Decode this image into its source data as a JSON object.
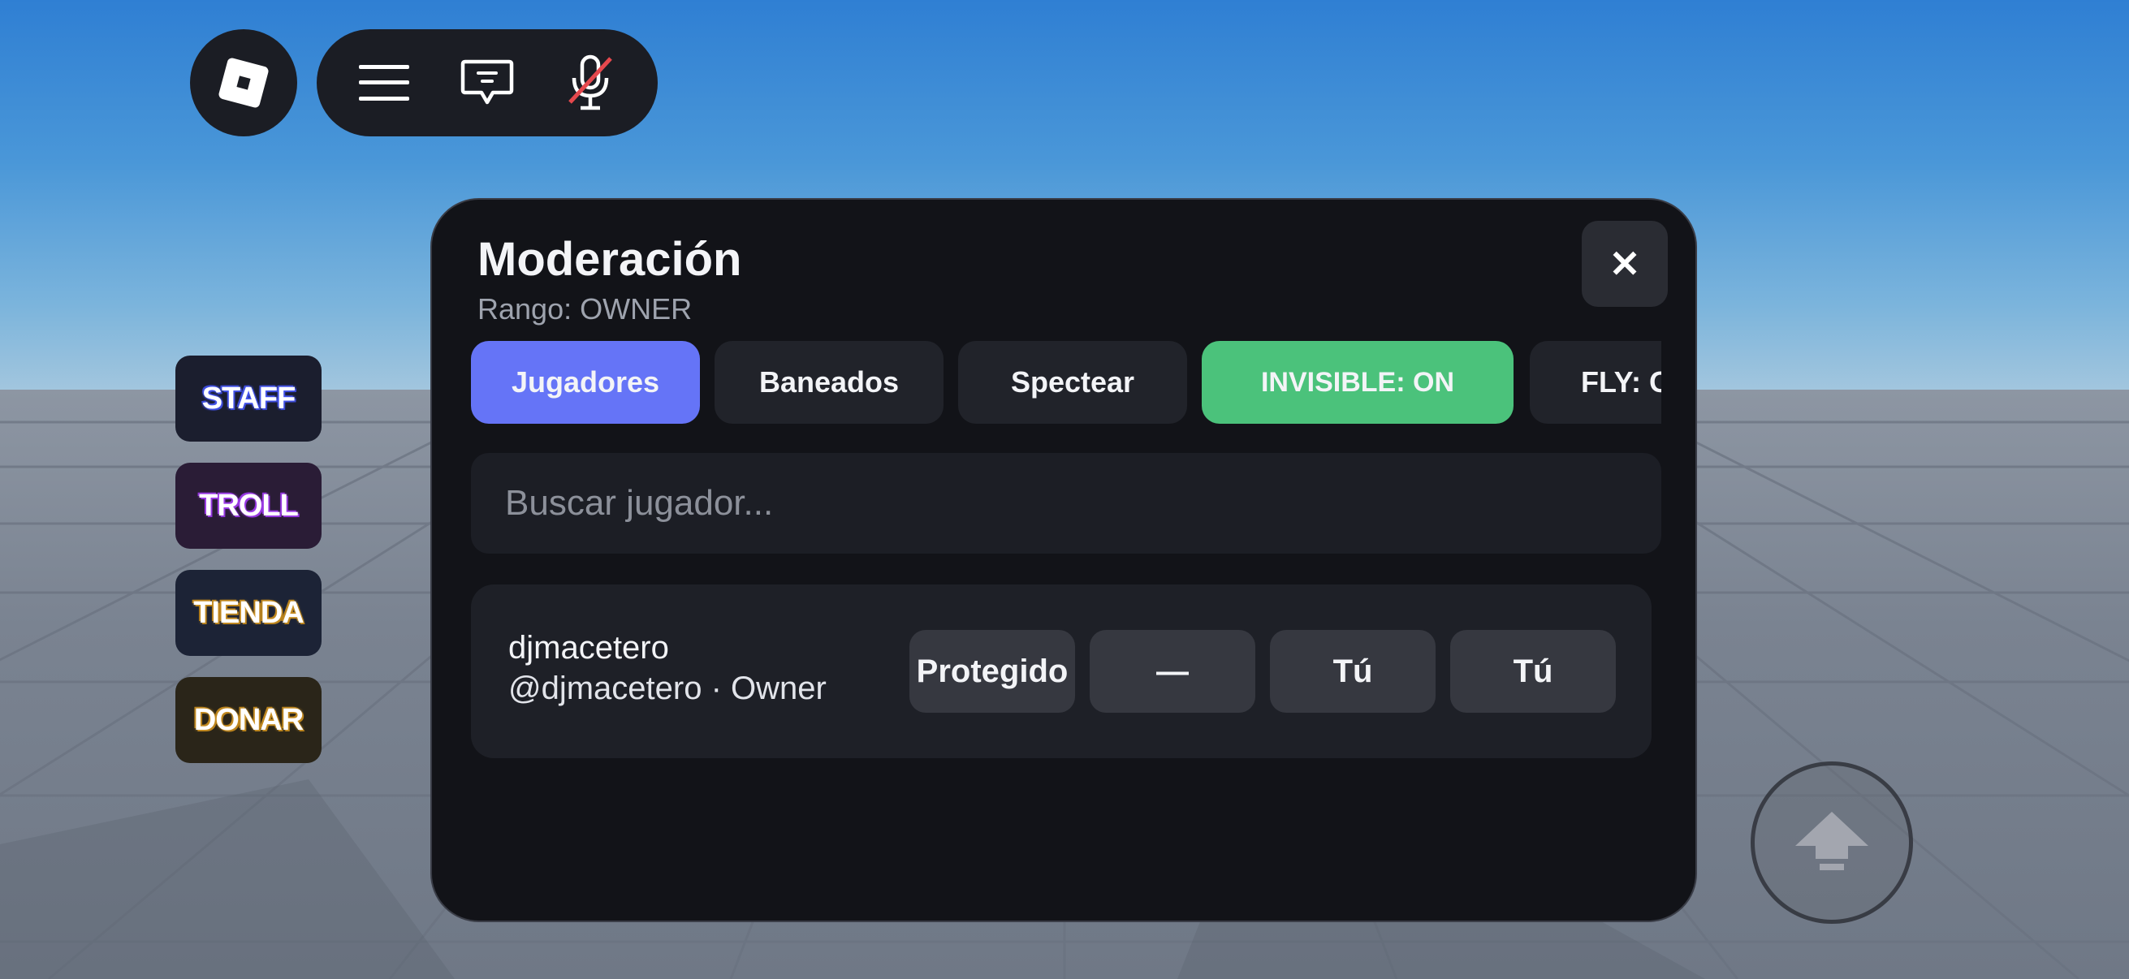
{
  "topbar": {
    "roblox_icon": "roblox-logo-icon",
    "menu_icon": "hamburger-menu-icon",
    "chat_icon": "chat-icon",
    "mic_icon": "microphone-muted-icon"
  },
  "side_buttons": {
    "staff": "STAFF",
    "troll": "TROLL",
    "tienda": "TIENDA",
    "donar": "DONAR"
  },
  "panel": {
    "title": "Moderación",
    "subtitle": "Rango: OWNER",
    "close_label": "✕",
    "tabs": [
      {
        "label": "Jugadores"
      },
      {
        "label": "Baneados"
      },
      {
        "label": "Spectear"
      },
      {
        "label": "INVISIBLE: ON"
      },
      {
        "label": "FLY: OFF"
      }
    ],
    "search": {
      "placeholder": "Buscar jugador...",
      "value": ""
    },
    "players": [
      {
        "name": "djmacetero",
        "subtitle": "@djmacetero · Owner",
        "actions": [
          "Protegido",
          "—",
          "Tú",
          "Tú"
        ]
      }
    ]
  },
  "jump_button": {
    "icon": "jump-arrow-icon"
  },
  "colors": {
    "accent": "#6574f7",
    "success": "#4bc27b",
    "panel_bg": "#121318"
  }
}
